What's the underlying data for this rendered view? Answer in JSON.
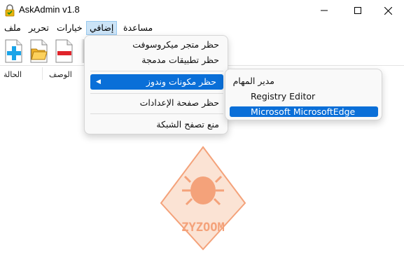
{
  "window": {
    "title": "AskAdmin v1.8",
    "minimize_icon": "minimize-icon",
    "maximize_icon": "maximize-icon",
    "close_icon": "close-icon"
  },
  "menubar": {
    "items": [
      "ملف",
      "تحرير",
      "خيارات",
      "إضافي",
      "مساعدة"
    ],
    "active": "إضافي"
  },
  "toolbar": {
    "buttons": [
      "add-icon",
      "open-folder-icon",
      "remove-icon"
    ]
  },
  "list": {
    "columns": [
      "الحالة",
      "الوصف"
    ]
  },
  "extra_menu": {
    "items": [
      "حظر متجر ميكروسوفت",
      "حظر تطبيقات مدمجة",
      "حظر مكونات وندوز",
      "حظر صفحة الإعدادات",
      "منع تصفح الشبكة"
    ],
    "highlighted": "حظر مكونات وندوز"
  },
  "submenu": {
    "items": [
      "مدير المهام",
      "Registry Editor",
      "Microsoft MicrosoftEdge"
    ],
    "highlighted": "Microsoft MicrosoftEdge"
  },
  "watermark": {
    "text": "ZYZOOM",
    "color": "#f4a27a"
  },
  "colors": {
    "highlight": "#0a6fd8",
    "menu_active_bg": "#cce4f7"
  }
}
